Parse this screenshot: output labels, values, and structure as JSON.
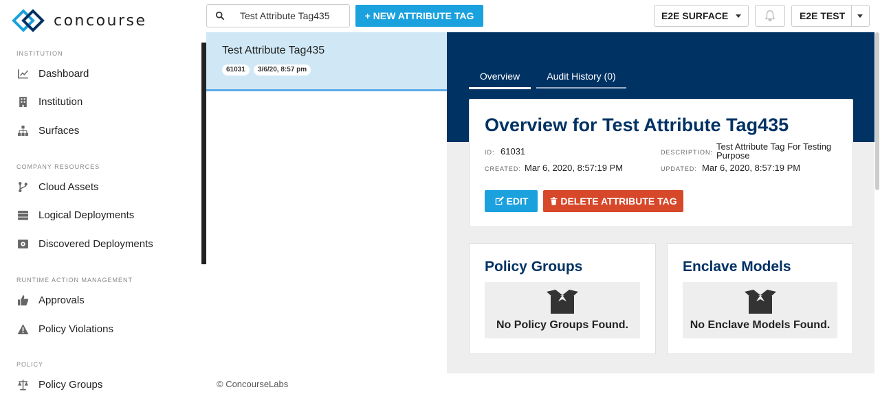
{
  "app": {
    "name": "concourse"
  },
  "sidebar": {
    "sections": [
      {
        "title": "INSTITUTION",
        "items": [
          {
            "label": "Dashboard",
            "icon": "chart-line-icon"
          },
          {
            "label": "Institution",
            "icon": "building-icon"
          },
          {
            "label": "Surfaces",
            "icon": "sitemap-icon"
          }
        ]
      },
      {
        "title": "COMPANY RESOURCES",
        "items": [
          {
            "label": "Cloud Assets",
            "icon": "branch-icon"
          },
          {
            "label": "Logical Deployments",
            "icon": "server-icon"
          },
          {
            "label": "Discovered Deployments",
            "icon": "radar-icon"
          }
        ]
      },
      {
        "title": "RUNTIME ACTION MANAGEMENT",
        "items": [
          {
            "label": "Approvals",
            "icon": "thumbs-up-icon"
          },
          {
            "label": "Policy Violations",
            "icon": "warning-icon"
          }
        ]
      },
      {
        "title": "POLICY",
        "items": [
          {
            "label": "Policy Groups",
            "icon": "balance-scale-icon"
          }
        ]
      }
    ]
  },
  "topbar": {
    "search_value": "Test Attribute Tag435",
    "new_button": "+ NEW ATTRIBUTE TAG",
    "surface_dropdown": "E2E SURFACE",
    "user_dropdown": "E2E TEST"
  },
  "list": {
    "items": [
      {
        "title": "Test Attribute Tag435",
        "id": "61031",
        "date": "3/6/20, 8:57 pm"
      }
    ]
  },
  "detail": {
    "tabs": [
      {
        "label": "Overview",
        "active": true
      },
      {
        "label": "Audit History (0)",
        "active": false
      }
    ],
    "overview": {
      "title": "Overview for Test Attribute Tag435",
      "id_label": "ID:",
      "id_value": "61031",
      "created_label": "CREATED:",
      "created_value": "Mar 6, 2020, 8:57:19 PM",
      "description_label": "DESCRIPTION:",
      "description_value": "Test Attribute Tag For Testing Purpose",
      "updated_label": "UPDATED:",
      "updated_value": "Mar 6, 2020, 8:57:19 PM",
      "edit_button": "EDIT",
      "delete_button": "DELETE ATTRIBUTE TAG"
    },
    "policy_groups": {
      "title": "Policy Groups",
      "empty": "No Policy Groups Found."
    },
    "enclave_models": {
      "title": "Enclave Models",
      "empty": "No Enclave Models Found."
    }
  },
  "footer": {
    "text": "© ConcourseLabs"
  },
  "colors": {
    "navy": "#003263",
    "accent": "#1aa1de",
    "danger": "#d7472a",
    "selected": "#d0e8f5"
  }
}
